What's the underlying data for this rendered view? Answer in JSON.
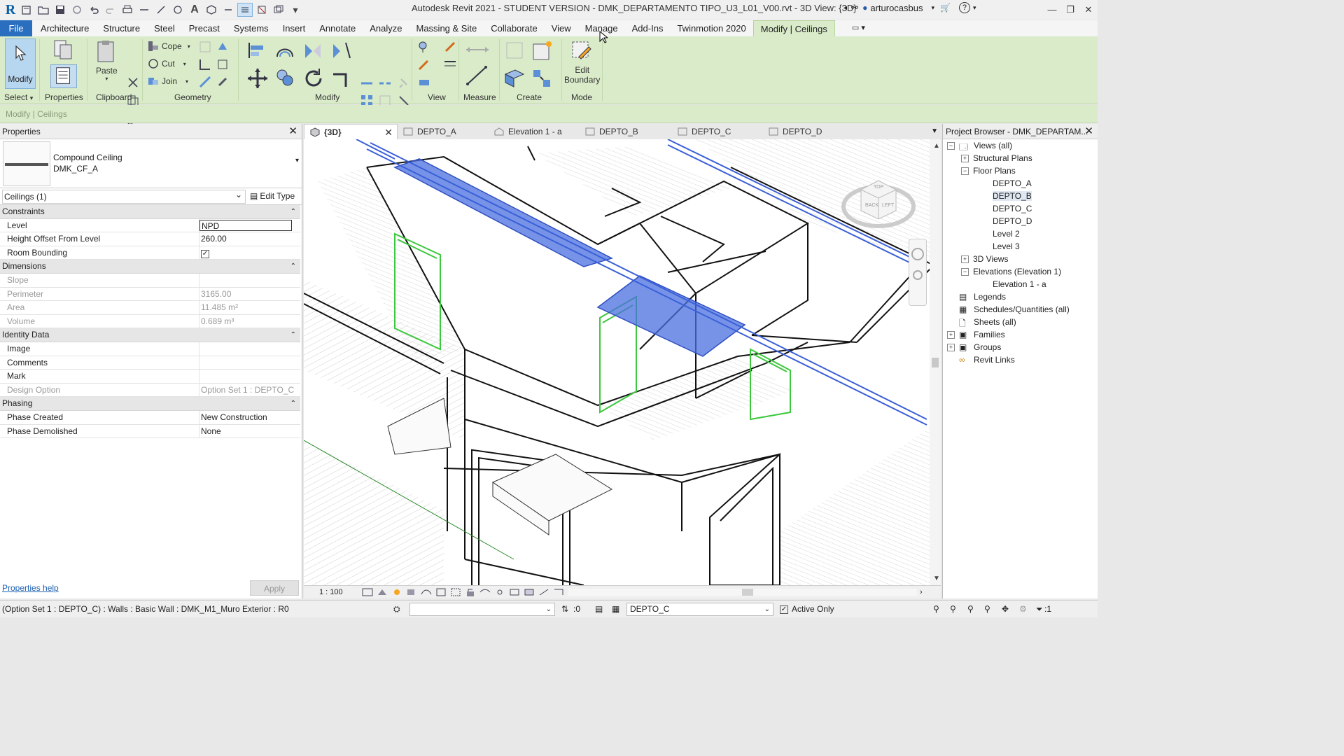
{
  "titlebar": {
    "title": "Autodesk Revit 2021 - STUDENT VERSION - DMK_DEPARTAMENTO TIPO_U3_L01_V00.rvt - 3D View: {3D}",
    "username": "arturocasbus"
  },
  "menu": {
    "tabs": [
      "File",
      "Architecture",
      "Structure",
      "Steel",
      "Precast",
      "Systems",
      "Insert",
      "Annotate",
      "Analyze",
      "Massing & Site",
      "Collaborate",
      "View",
      "Manage",
      "Add-Ins",
      "Twinmotion 2020",
      "Modify | Ceilings"
    ],
    "active_index": 15
  },
  "ribbon": {
    "modify_label": "Modify",
    "paste_label": "Paste",
    "cope_label": "Cope",
    "cut_label": "Cut",
    "join_label": "Join",
    "edit_boundary_label_1": "Edit",
    "edit_boundary_label_2": "Boundary",
    "panels": {
      "select": "Select",
      "properties": "Properties",
      "clipboard": "Clipboard",
      "geometry": "Geometry",
      "modify": "Modify",
      "view": "View",
      "measure": "Measure",
      "create": "Create",
      "mode": "Mode"
    }
  },
  "options_bar": {
    "context": "Modify | Ceilings"
  },
  "properties": {
    "header": "Properties",
    "type_name_1": "Compound Ceiling",
    "type_name_2": "DMK_CF_A",
    "instance_selector": "Ceilings (1)",
    "edit_type": "Edit Type",
    "groups": {
      "constraints": "Constraints",
      "dimensions": "Dimensions",
      "identity": "Identity Data",
      "phasing": "Phasing"
    },
    "rows": {
      "level": {
        "name": "Level",
        "value": "NPD"
      },
      "height_offset": {
        "name": "Height Offset From Level",
        "value": "260.00"
      },
      "room_bounding": {
        "name": "Room Bounding",
        "value": "✓"
      },
      "slope": {
        "name": "Slope",
        "value": ""
      },
      "perimeter": {
        "name": "Perimeter",
        "value": "3165.00"
      },
      "area": {
        "name": "Area",
        "value": "11.485 m²"
      },
      "volume": {
        "name": "Volume",
        "value": "0.689 m³"
      },
      "image": {
        "name": "Image",
        "value": ""
      },
      "comments": {
        "name": "Comments",
        "value": ""
      },
      "mark": {
        "name": "Mark",
        "value": ""
      },
      "design_option": {
        "name": "Design Option",
        "value": "Option Set 1 : DEPTO_C"
      },
      "phase_created": {
        "name": "Phase Created",
        "value": "New Construction"
      },
      "phase_demolished": {
        "name": "Phase Demolished",
        "value": "None"
      }
    },
    "help_link": "Properties help",
    "apply": "Apply"
  },
  "view_tabs": [
    "{3D}",
    "DEPTO_A",
    "Elevation 1 - a",
    "DEPTO_B",
    "DEPTO_C",
    "DEPTO_D"
  ],
  "view_scale": "1 : 100",
  "project_browser": {
    "header": "Project Browser - DMK_DEPARTAM...",
    "items": {
      "views_all": "Views (all)",
      "structural_plans": "Structural Plans",
      "floor_plans": "Floor Plans",
      "depto_a": "DEPTO_A",
      "depto_b": "DEPTO_B",
      "depto_c": "DEPTO_C",
      "depto_d": "DEPTO_D",
      "level_2": "Level 2",
      "level_3": "Level 3",
      "views_3d": "3D Views",
      "elevations": "Elevations (Elevation 1)",
      "elevation_1a": "Elevation 1 - a",
      "legends": "Legends",
      "schedules": "Schedules/Quantities (all)",
      "sheets": "Sheets (all)",
      "families": "Families",
      "groups": "Groups",
      "revit_links": "Revit Links"
    }
  },
  "viewcube": {
    "top": "TOP",
    "back": "BACK",
    "left": "LEFT"
  },
  "status_bar": {
    "text": "(Option Set 1 : DEPTO_C) : Walls : Basic Wall : DMK_M1_Muro Exterior : R0",
    "selection_count": ":0",
    "design_option": "DEPTO_C",
    "active_only": "Active Only",
    "filter_count": ":1"
  },
  "colors": {
    "ribbon_bg": "#d9ebc8",
    "file_tab": "#2a6fbf",
    "selection_blue": "#4a6fe0",
    "door_green": "#3cc83c",
    "brand_red": "#d40f1a"
  }
}
